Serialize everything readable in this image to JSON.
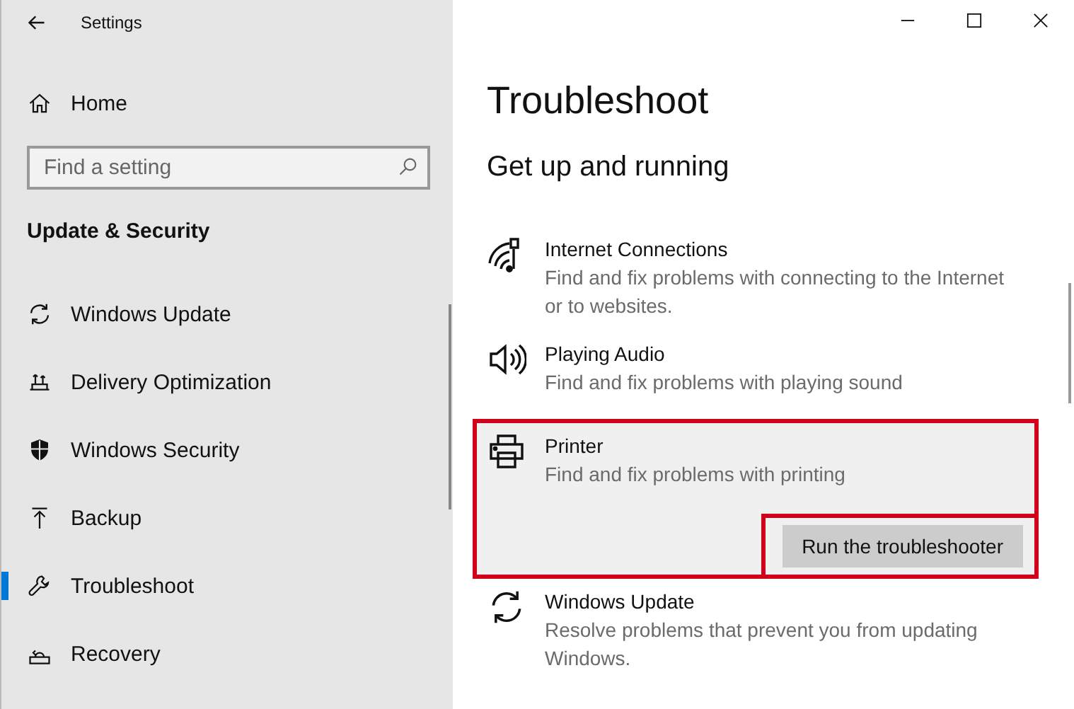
{
  "window": {
    "title": "Settings"
  },
  "sidebar": {
    "home": "Home",
    "search": {
      "placeholder": "Find a setting"
    },
    "section": "Update & Security",
    "items": [
      {
        "label": "Windows Update",
        "selected": false
      },
      {
        "label": "Delivery Optimization",
        "selected": false
      },
      {
        "label": "Windows Security",
        "selected": false
      },
      {
        "label": "Backup",
        "selected": false
      },
      {
        "label": "Troubleshoot",
        "selected": true
      },
      {
        "label": "Recovery",
        "selected": false
      }
    ]
  },
  "page": {
    "title": "Troubleshoot",
    "subtitle": "Get up and running",
    "troubleshooters": [
      {
        "title": "Internet Connections",
        "description": "Find and fix problems with connecting to the Internet or to websites.",
        "expanded": false,
        "highlighted": false
      },
      {
        "title": "Playing Audio",
        "description": "Find and fix problems with playing sound",
        "expanded": false,
        "highlighted": false
      },
      {
        "title": "Printer",
        "description": "Find and fix problems with printing",
        "expanded": true,
        "highlighted": true,
        "button": {
          "label": "Run the troubleshooter",
          "highlighted": true
        }
      },
      {
        "title": "Windows Update",
        "description": "Resolve problems that prevent you from updating Windows.",
        "expanded": false,
        "highlighted": false
      }
    ]
  }
}
